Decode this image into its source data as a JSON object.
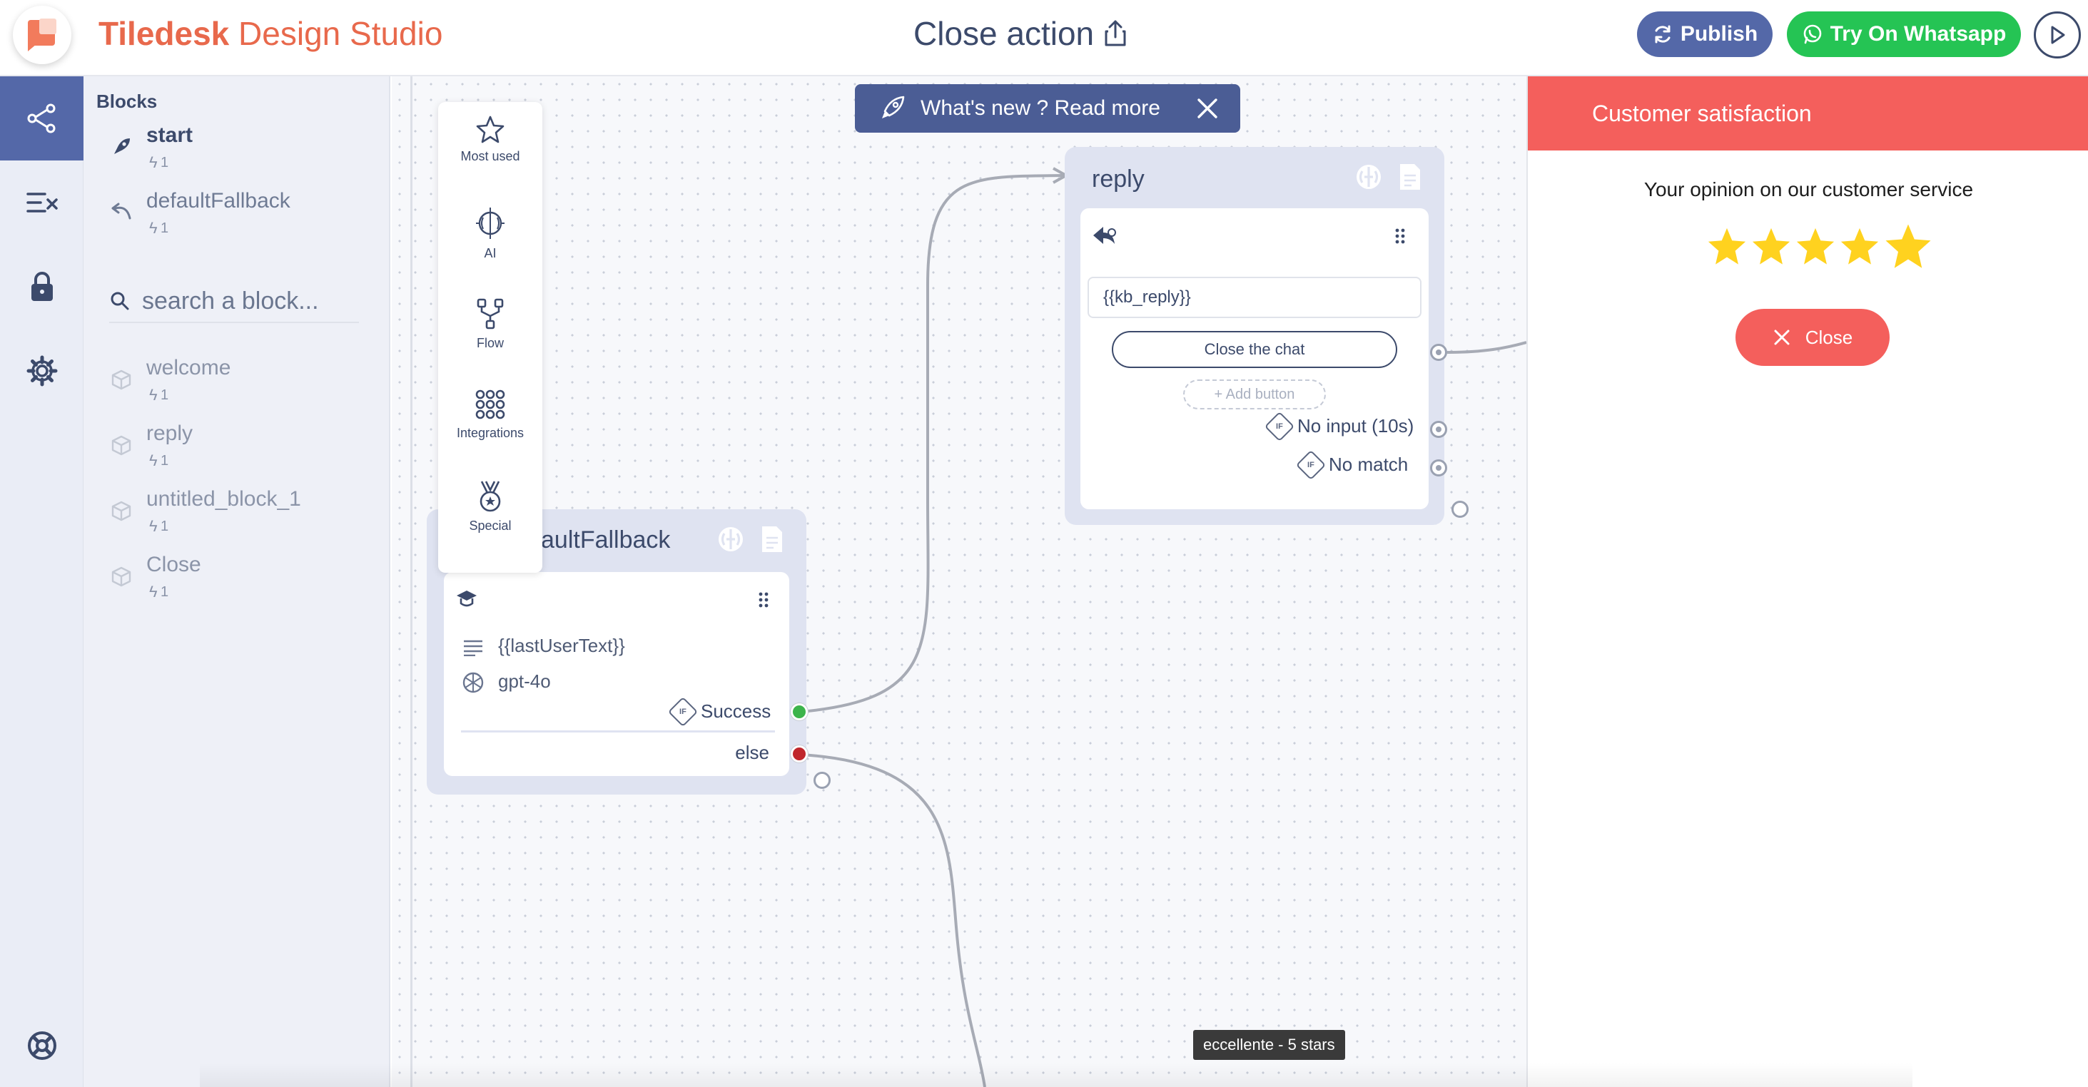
{
  "header": {
    "brand_bold": "Tiledesk",
    "brand_rest": "Design Studio",
    "title": "Close action",
    "publish_label": "Publish",
    "whatsapp_label": "Try On Whatsapp"
  },
  "blocks_panel": {
    "title": "Blocks",
    "main_blocks": [
      {
        "name": "start",
        "count": "1",
        "icon": "rocket-icon"
      },
      {
        "name": "defaultFallback",
        "count": "1",
        "icon": "undo-icon"
      }
    ],
    "search_placeholder": "search a block...",
    "other_blocks": [
      {
        "name": "welcome",
        "count": "1"
      },
      {
        "name": "reply",
        "count": "1"
      },
      {
        "name": "untitled_block_1",
        "count": "1"
      },
      {
        "name": "Close",
        "count": "1"
      }
    ]
  },
  "palette": {
    "items": [
      {
        "label": "Most used",
        "icon": "star-icon"
      },
      {
        "label": "AI",
        "icon": "ai-brain-icon"
      },
      {
        "label": "Flow",
        "icon": "flow-icon"
      },
      {
        "label": "Integrations",
        "icon": "integrations-icon"
      },
      {
        "label": "Special",
        "icon": "medal-icon"
      }
    ]
  },
  "whats_new": {
    "text": "What's new ? Read more"
  },
  "fallback_node": {
    "title": "defaultFallback",
    "title_visible": "aultFallback",
    "question": "{{lastUserText}}",
    "model": "gpt-4o",
    "success_label": "Success",
    "else_label": "else"
  },
  "reply_node": {
    "title": "reply",
    "text": "{{kb_reply}}",
    "button_label": "Close the chat",
    "add_button_label": "+ Add button",
    "no_input_label": "No input (10s)",
    "no_match_label": "No match"
  },
  "preview": {
    "header": "Customer satisfaction",
    "question": "Your opinion on our customer service",
    "rating": 5,
    "rating_max": 5,
    "star_color": "#ffd21f",
    "close_label": "Close"
  },
  "tooltip": {
    "text": "eccellente - 5 stars"
  },
  "colors": {
    "brand": "#e8694c",
    "primary": "#5468a8",
    "whatsapp": "#25c454",
    "danger": "#f45f5c",
    "success_port": "#3cb44b",
    "else_port": "#c0262c"
  }
}
